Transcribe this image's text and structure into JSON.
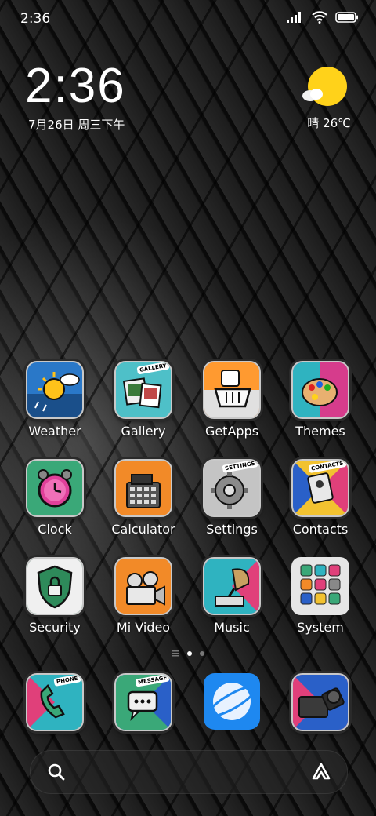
{
  "status_bar": {
    "time": "2:36"
  },
  "clock_widget": {
    "time": "2:36",
    "date": "7月26日 周三下午"
  },
  "weather_widget": {
    "text": "晴 26℃",
    "icon": "sun-cloud-icon"
  },
  "apps": [
    {
      "label": "Weather",
      "icon": "weather-icon"
    },
    {
      "label": "Gallery",
      "icon": "gallery-icon",
      "badge": "GALLERY"
    },
    {
      "label": "GetApps",
      "icon": "getapps-icon"
    },
    {
      "label": "Themes",
      "icon": "themes-icon"
    },
    {
      "label": "Clock",
      "icon": "clock-icon"
    },
    {
      "label": "Calculator",
      "icon": "calculator-icon"
    },
    {
      "label": "Settings",
      "icon": "settings-icon",
      "badge": "SETTINGS"
    },
    {
      "label": "Contacts",
      "icon": "contacts-icon",
      "badge": "CONTACTS"
    },
    {
      "label": "Security",
      "icon": "security-icon"
    },
    {
      "label": "Mi Video",
      "icon": "video-icon"
    },
    {
      "label": "Music",
      "icon": "music-icon"
    },
    {
      "label": "System",
      "icon": "system-folder-icon"
    }
  ],
  "dock": [
    {
      "icon": "phone-icon",
      "badge": "PHONE"
    },
    {
      "icon": "message-icon",
      "badge": "MESSAGE"
    },
    {
      "icon": "browser-icon"
    },
    {
      "icon": "camera-icon"
    }
  ],
  "page_indicator": {
    "pages": 2,
    "active": 1
  },
  "colors": {
    "accent_yellow": "#ffd21a",
    "weather_blue": "#2a78c8",
    "browser_blue": "#1e88f0"
  }
}
